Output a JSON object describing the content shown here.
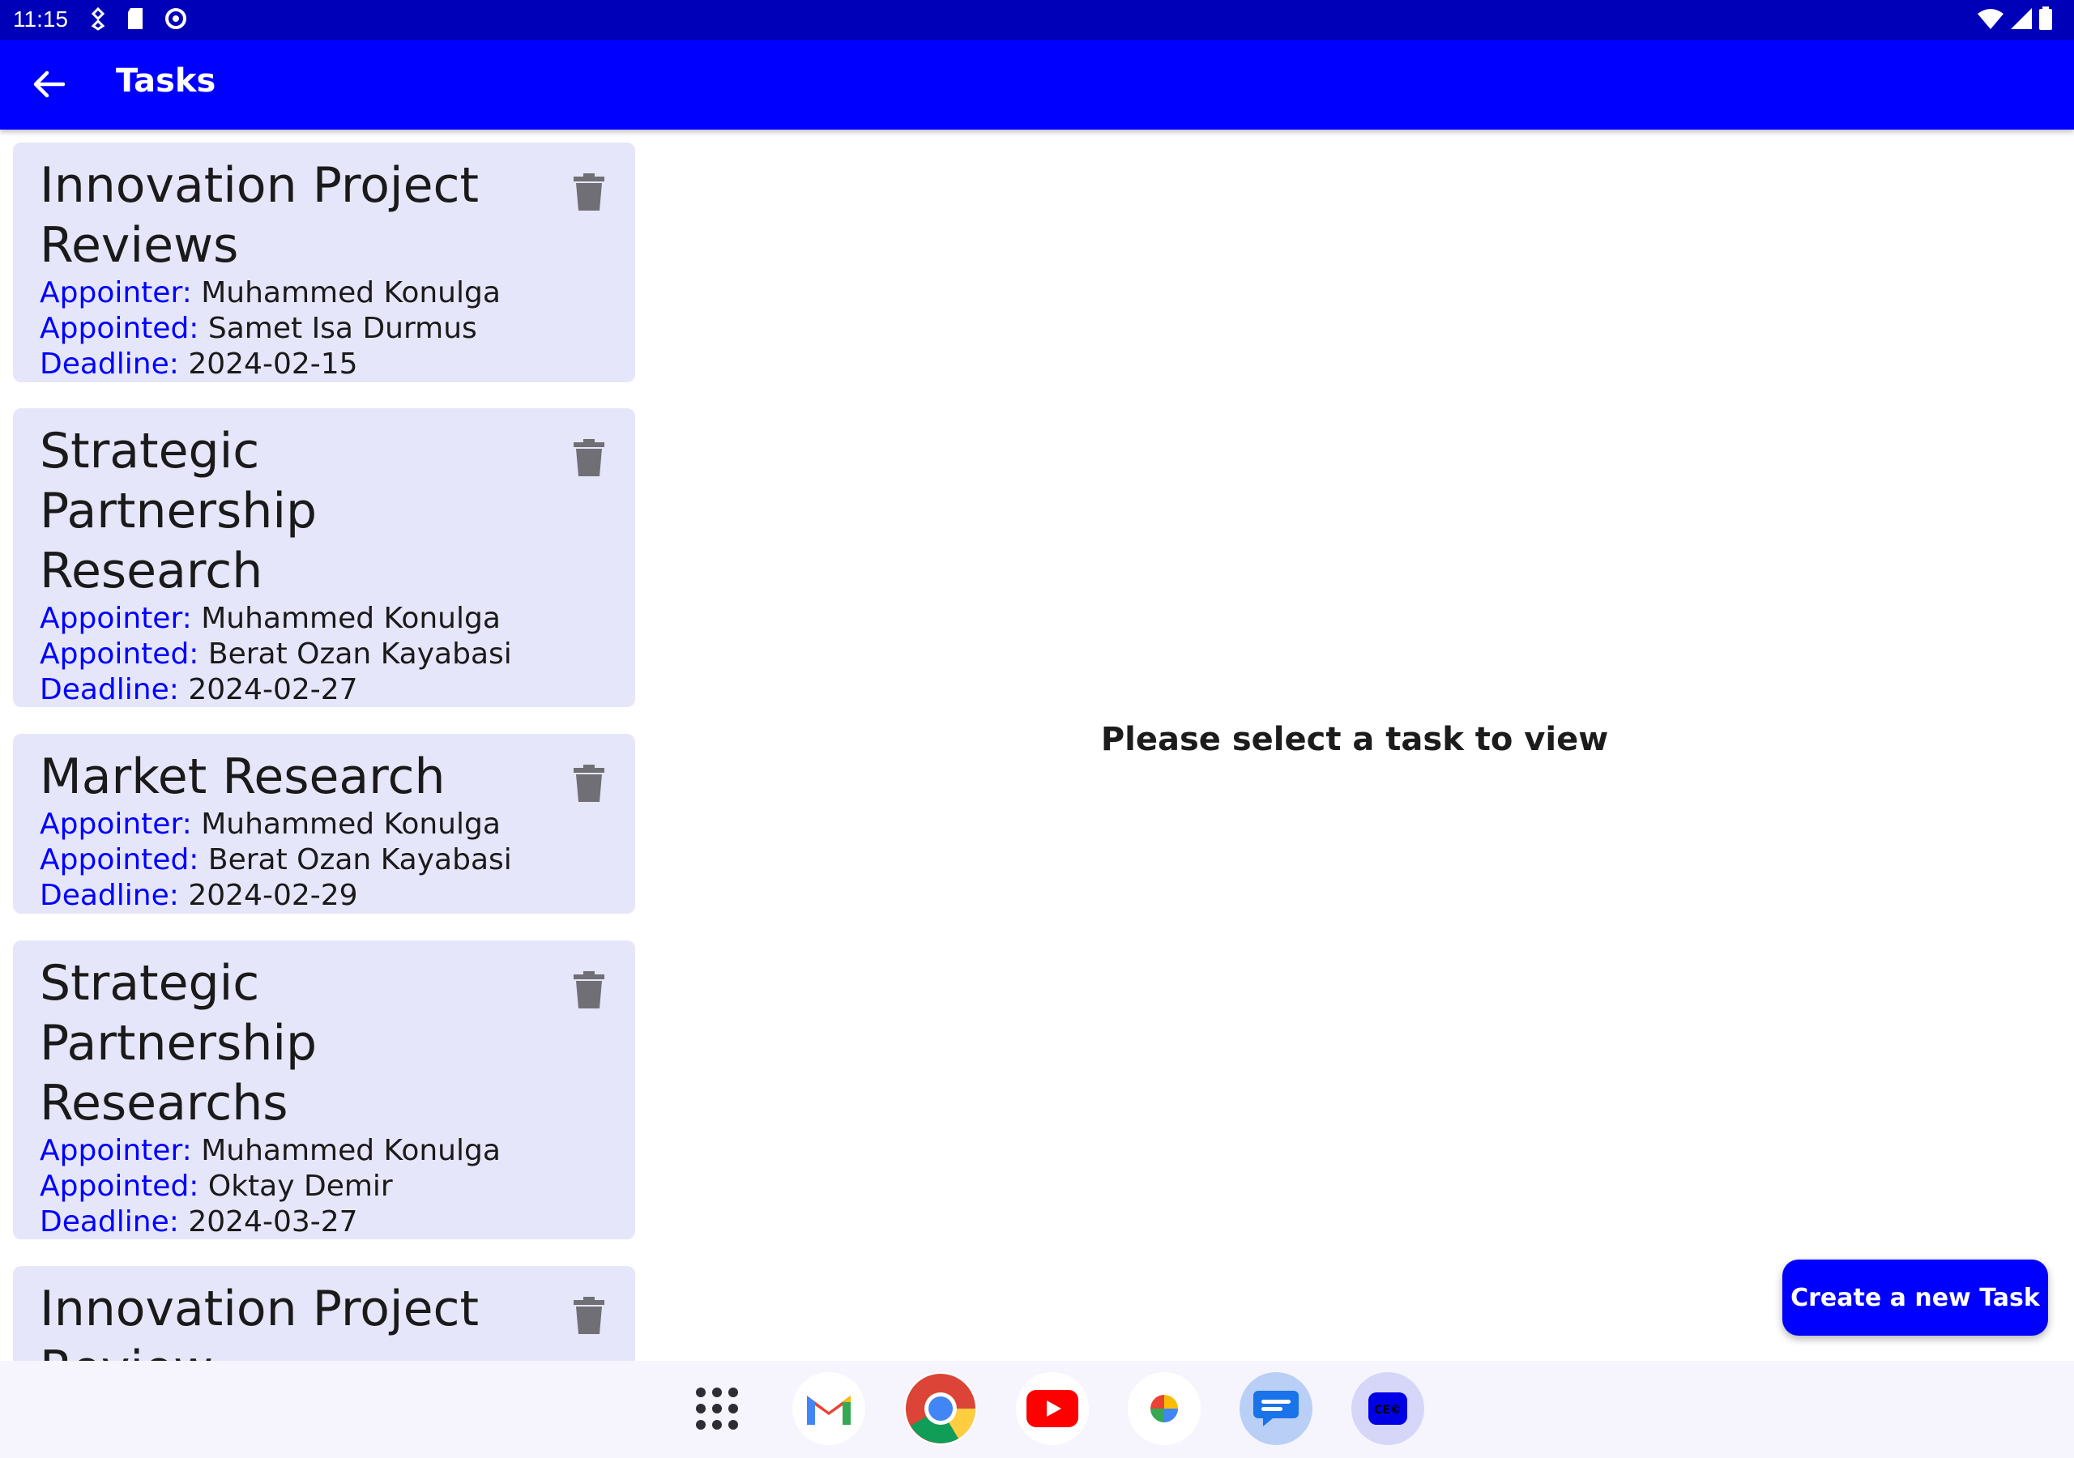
{
  "status_bar": {
    "time": "11:15"
  },
  "app_bar": {
    "title": "Tasks"
  },
  "tasks": [
    {
      "title": "Innovation Project Reviews",
      "appointer_label": "Appointer:",
      "appointer": "Muhammed Konulga",
      "appointed_label": "Appointed:",
      "appointed": "Samet Isa Durmus",
      "deadline_label": "Deadline:",
      "deadline": "2024-02-15"
    },
    {
      "title": "Strategic Partnership Research",
      "appointer_label": "Appointer:",
      "appointer": "Muhammed Konulga",
      "appointed_label": "Appointed:",
      "appointed": "Berat Ozan Kayabasi",
      "deadline_label": "Deadline:",
      "deadline": "2024-02-27"
    },
    {
      "title": "Market Research",
      "appointer_label": "Appointer:",
      "appointer": "Muhammed Konulga",
      "appointed_label": "Appointed:",
      "appointed": "Berat Ozan Kayabasi",
      "deadline_label": "Deadline:",
      "deadline": "2024-02-29"
    },
    {
      "title": "Strategic Partnership Researchs",
      "appointer_label": "Appointer:",
      "appointer": "Muhammed Konulga",
      "appointed_label": "Appointed:",
      "appointed": "Oktay Demir",
      "deadline_label": "Deadline:",
      "deadline": "2024-03-27"
    },
    {
      "title": "Innovation Project Review",
      "appointer_label": "",
      "appointer": "",
      "appointed_label": "",
      "appointed": "",
      "deadline_label": "",
      "deadline": ""
    }
  ],
  "main": {
    "empty_message": "Please select a task to view"
  },
  "fab": {
    "label": "Create a new Task"
  },
  "taskbar": {
    "apps": [
      "app-drawer-icon",
      "gmail-icon",
      "chrome-icon",
      "youtube-icon",
      "photos-icon",
      "messages-icon",
      "task-app-icon"
    ]
  },
  "colors": {
    "status_bar": "#0000b8",
    "app_bar": "#0000ff",
    "card_bg": "#e6e6fa",
    "label": "#0000ff"
  }
}
